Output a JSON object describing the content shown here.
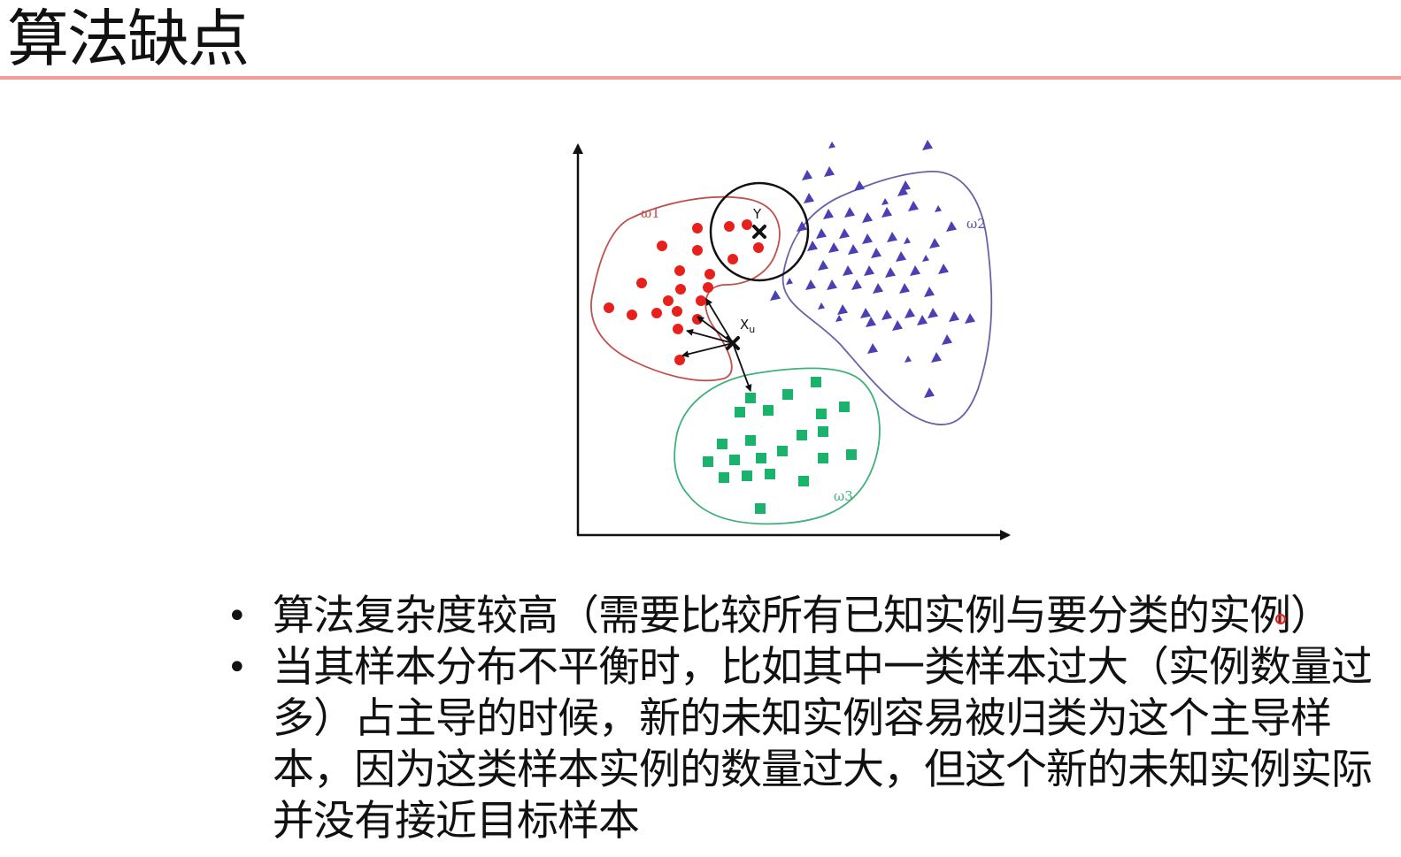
{
  "title": "算法缺点",
  "diagram": {
    "class_labels": {
      "w1": "ω1",
      "w2": "ω2",
      "w3": "ω3"
    },
    "point_labels": {
      "y": "Y",
      "xu": "Xu"
    },
    "colors": {
      "class1": "#e8201c",
      "class2": "#4a3fb5",
      "class3": "#19b36b",
      "outline1": "#c0504d",
      "outline2": "#6a62a8",
      "outline3": "#3fb07a"
    }
  },
  "bullets": [
    "算法复杂度较高（需要比较所有已知实例与要分类的实例）",
    "当其样本分布不平衡时，比如其中一类样本过大（实例数量过多）占主导的时候，新的未知实例容易被归类为这个主导样本，因为这类样本实例的数量过大，但这个新的未知实例实际并没有接近目标样本"
  ]
}
